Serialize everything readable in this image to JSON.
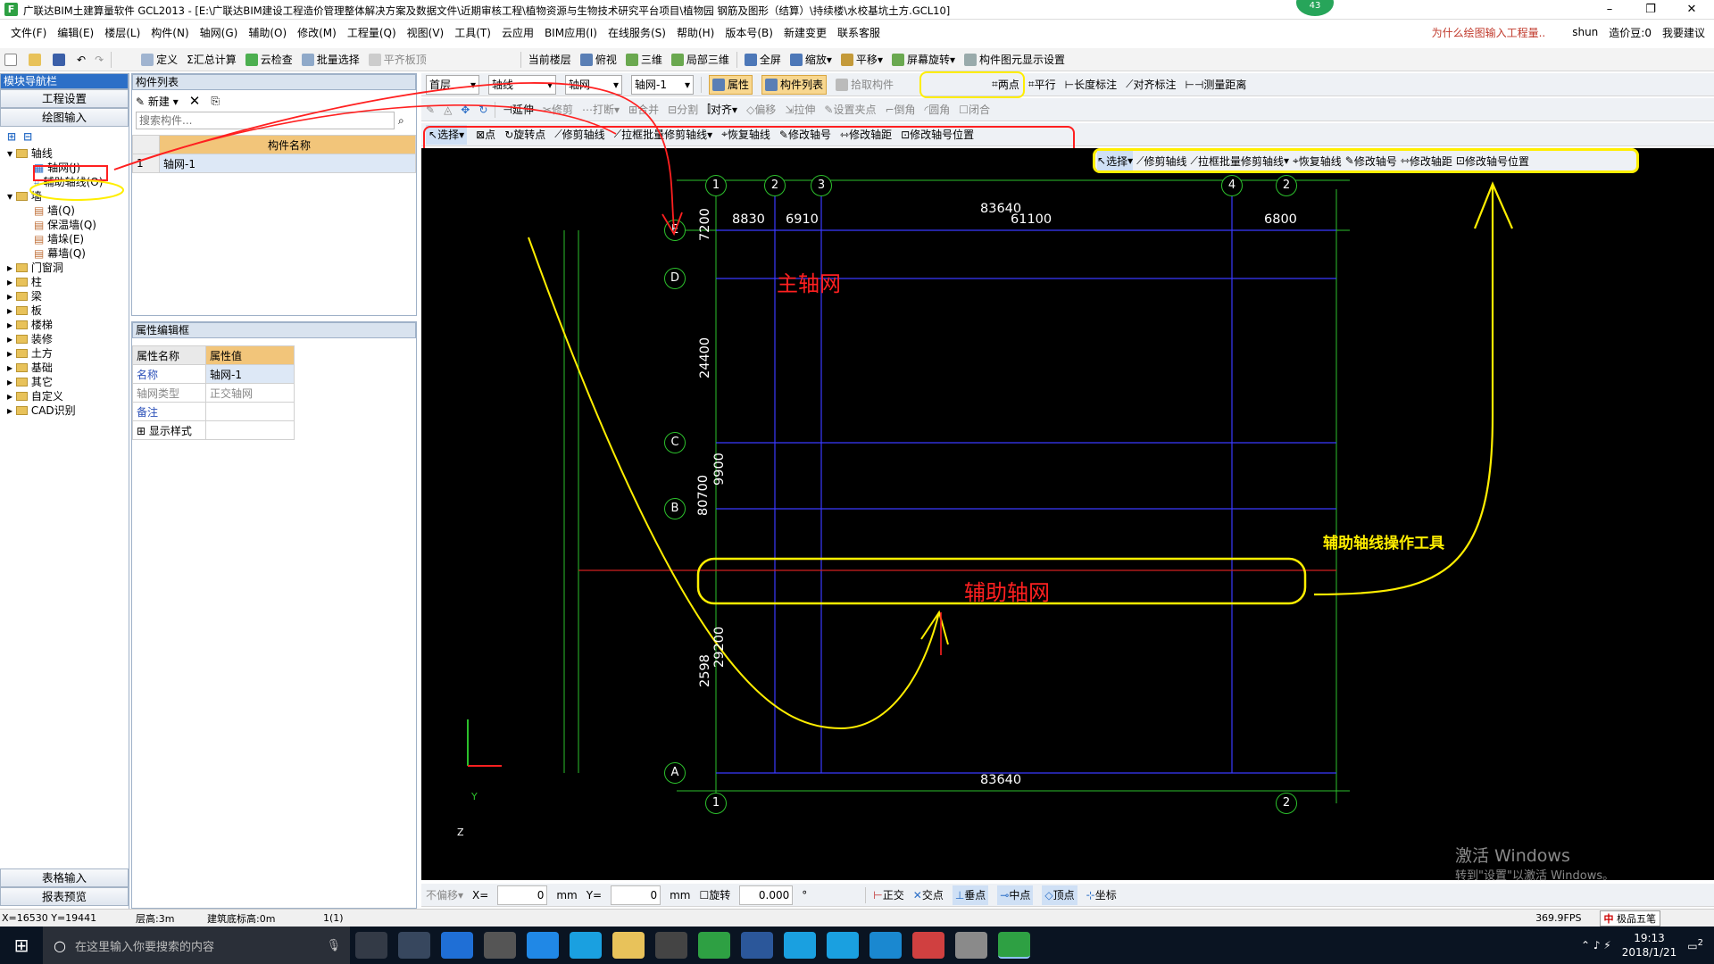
{
  "title_bar": {
    "title": "广联达BIM土建算量软件 GCL2013 - [E:\\广联达BIM建设工程造价管理整体解决方案及数据文件\\近期审核工程\\植物资源与生物技术研究平台项目\\植物园 钢筋及图形（结算）\\持续楼\\水校基坑土方.GCL10]",
    "badge": "43",
    "help_link": "为什么绘图输入工程量..",
    "user": "shun",
    "coin": "造价豆:0",
    "feedback": "我要建议"
  },
  "menu": [
    "文件(F)",
    "编辑(E)",
    "楼层(L)",
    "构件(N)",
    "轴网(G)",
    "辅助(O)",
    "修改(M)",
    "工程量(Q)",
    "视图(V)",
    "工具(T)",
    "云应用",
    "BIM应用(I)",
    "在线服务(S)",
    "帮助(H)",
    "版本号(B)",
    "新建变更",
    "联系客服"
  ],
  "toolbar1": [
    "定义",
    "汇总计算",
    "云检查",
    "批量选择",
    "平齐板顶",
    "当前楼层",
    "俯视",
    "三维",
    "局部三维",
    "全屏",
    "缩放",
    "平移",
    "屏幕旋转",
    "构件图元显示设置"
  ],
  "toolbar2": {
    "floor": "首层",
    "type": "轴线",
    "subtype": "轴网",
    "component": "轴网-1",
    "buttons": [
      "属性",
      "构件列表",
      "拾取构件",
      "两点",
      "平行",
      "长度标注",
      "对齐标注",
      "测量距离"
    ]
  },
  "toolbar3": [
    "延伸",
    "修剪",
    "打断",
    "合并",
    "分割",
    "对齐",
    "偏移",
    "拉伸",
    "设置夹点",
    "倒角",
    "圆角",
    "闭合"
  ],
  "toolbar4": [
    "选择",
    "点",
    "旋转点",
    "修剪轴线",
    "拉框批量修剪轴线",
    "恢复轴线",
    "修改轴号",
    "修改轴距",
    "修改轴号位置"
  ],
  "nav": {
    "header": "模块导航栏",
    "btn_setup": "工程设置",
    "btn_draw": "绘图输入",
    "tree": {
      "axis_folder": "轴线",
      "axis_grid": "轴网(J)",
      "aux_axis": "辅助轴线(O)",
      "wall_folder": "墙",
      "walls": [
        "墙(Q)",
        "保温墙(Q)",
        "墙垛(E)",
        "幕墙(Q)"
      ],
      "folders": [
        "门窗洞",
        "柱",
        "梁",
        "板",
        "楼梯",
        "装修",
        "土方",
        "基础",
        "其它",
        "自定义",
        "CAD识别"
      ]
    },
    "btn_table": "表格输入",
    "btn_report": "报表预览"
  },
  "component_list": {
    "header": "构件列表",
    "new_btn": "新建",
    "search_placeholder": "搜索构件...",
    "col": "构件名称",
    "rows": [
      {
        "num": "1",
        "name": "轴网-1"
      }
    ]
  },
  "props": {
    "header": "属性编辑框",
    "col_name": "属性名称",
    "col_value": "属性值",
    "rows": [
      {
        "name": "名称",
        "value": "轴网-1"
      },
      {
        "name": "轴网类型",
        "value": "正交轴网"
      },
      {
        "name": "备注",
        "value": ""
      },
      {
        "name": "显示样式",
        "value": ""
      }
    ]
  },
  "canvas": {
    "top_labels": [
      "1",
      "2",
      "3",
      "4",
      "2"
    ],
    "left_labels": [
      "E",
      "D",
      "C",
      "B",
      "A"
    ],
    "bottom_labels": [
      "1",
      "2"
    ],
    "dims_top": [
      "8830",
      "6910",
      "83640",
      "61100",
      "6800"
    ],
    "dims_left": [
      "7200",
      "24400",
      "9900",
      "80700",
      "29200",
      "2598"
    ],
    "dim_bottom": "83640",
    "main_grid_label": "主轴网",
    "aux_grid_label": "辅助轴网",
    "aux_tools_label": "辅助轴线操作工具",
    "activate_title": "激活 Windows",
    "activate_sub": "转到\"设置\"以激活 Windows。",
    "axis_y": "Y",
    "axis_z": "Z"
  },
  "floating_toolbar": [
    "选择",
    "修剪轴线",
    "拉框批量修剪轴线",
    "恢复轴线",
    "修改轴号",
    "修改轴距",
    "修改轴号位置"
  ],
  "bottom_toolbar": {
    "offset": "不偏移",
    "x_label": "X=",
    "x_val": "0",
    "y_label": "Y=",
    "y_val": "0",
    "unit": "mm",
    "rotate": "旋转",
    "rotate_val": "0.000",
    "degree": "°",
    "snaps": [
      "正交",
      "交点",
      "垂点",
      "中点",
      "顶点",
      "坐标"
    ]
  },
  "status": {
    "coords": "X=16530 Y=19441",
    "floor_h": "层高:3m",
    "base": "建筑底标高:0m",
    "count": "1(1)",
    "fps": "369.9FPS",
    "ime": "极品五笔"
  },
  "taskbar": {
    "search": "在这里输入你要搜索的内容",
    "time": "19:13",
    "date": "2018/1/21",
    "notify": "2"
  },
  "colors": {
    "annot_red": "#ff2020",
    "annot_yellow": "#ffee00",
    "grid_blue": "#3a3aff",
    "grid_green": "#2cc02c"
  }
}
